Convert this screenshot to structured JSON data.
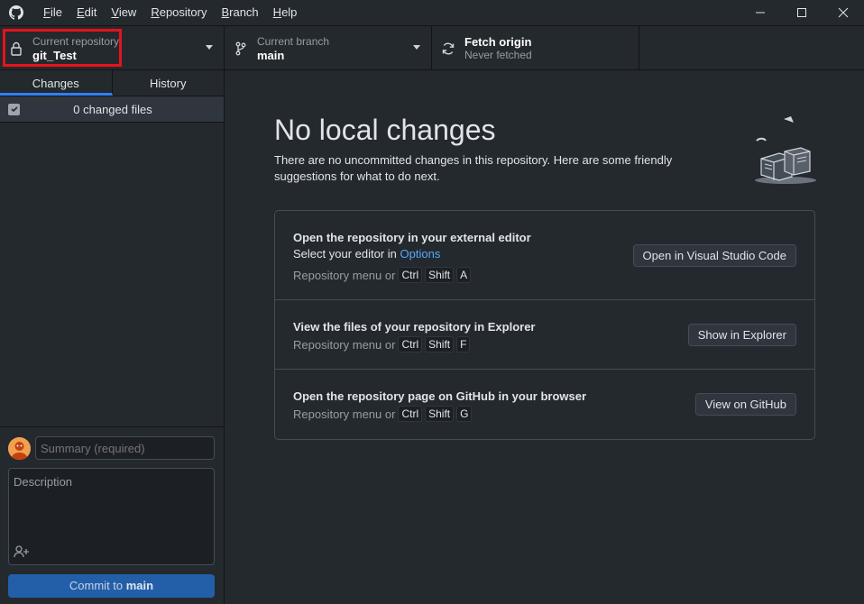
{
  "menu": {
    "items": [
      {
        "underline": "F",
        "rest": "ile"
      },
      {
        "underline": "E",
        "rest": "dit"
      },
      {
        "underline": "V",
        "rest": "iew"
      },
      {
        "underline": "R",
        "rest": "epository"
      },
      {
        "underline": "B",
        "rest": "ranch"
      },
      {
        "underline": "H",
        "rest": "elp"
      }
    ]
  },
  "toolbar": {
    "repo_sub": "Current repository",
    "repo_name": "git_Test",
    "branch_sub": "Current branch",
    "branch_name": "main",
    "fetch_title": "Fetch origin",
    "fetch_sub": "Never fetched"
  },
  "sidebar": {
    "tabs": [
      "Changes",
      "History"
    ],
    "changed_files": "0 changed files"
  },
  "commit": {
    "summary_placeholder": "Summary (required)",
    "description_placeholder": "Description",
    "button_prefix": "Commit to ",
    "button_branch": "main"
  },
  "main": {
    "heading": "No local changes",
    "intro": "There are no uncommitted changes in this repository. Here are some friendly suggestions for what to do next.",
    "suggestions": [
      {
        "title": "Open the repository in your external editor",
        "line_prefix": "Select your editor in ",
        "line_link": "Options",
        "hint": "Repository menu or",
        "keys": [
          "Ctrl",
          "Shift",
          "A"
        ],
        "button": "Open in Visual Studio Code"
      },
      {
        "title": "View the files of your repository in Explorer",
        "hint": "Repository menu or",
        "keys": [
          "Ctrl",
          "Shift",
          "F"
        ],
        "button": "Show in Explorer"
      },
      {
        "title": "Open the repository page on GitHub in your browser",
        "hint": "Repository menu or",
        "keys": [
          "Ctrl",
          "Shift",
          "G"
        ],
        "button": "View on GitHub"
      }
    ]
  },
  "icons": {
    "app": "github-icon",
    "repo": "lock-icon",
    "branch": "git-branch-icon",
    "fetch": "sync-icon",
    "minimize": "minimize-icon",
    "maximize": "maximize-icon",
    "close": "close-icon",
    "coauthor": "person-add-icon"
  },
  "colors": {
    "accent": "#2f81f7",
    "highlight": "#e8121b",
    "commit_button": "#235ea8",
    "link": "#58a6ff"
  }
}
